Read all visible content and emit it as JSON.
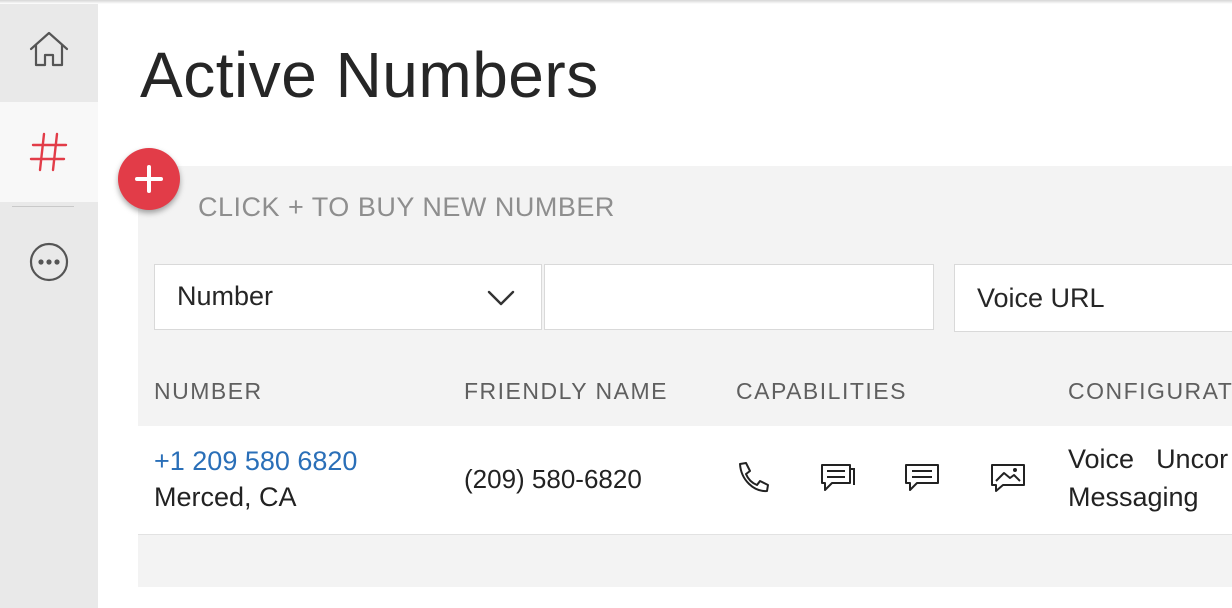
{
  "sidebar": {
    "items": [
      {
        "icon": "home-icon"
      },
      {
        "icon": "hash-icon",
        "active": true
      },
      {
        "icon": "more-icon"
      }
    ]
  },
  "page": {
    "title": "Active Numbers"
  },
  "buy": {
    "text": "CLICK + TO BUY NEW NUMBER"
  },
  "filters": {
    "field_select_value": "Number",
    "search_value": "",
    "voice_url_label": "Voice URL"
  },
  "table": {
    "columns": [
      "NUMBER",
      "FRIENDLY NAME",
      "CAPABILITIES",
      "CONFIGURAT"
    ],
    "rows": [
      {
        "number": "+1 209 580 6820",
        "location": "Merced, CA",
        "friendly_name": "(209) 580-6820",
        "capabilities": [
          "voice-icon",
          "sms-icon",
          "mms-icon",
          "fax-icon"
        ],
        "config": [
          {
            "label": "Voice",
            "value": "Uncor"
          },
          {
            "label": "Messaging",
            "value": ""
          }
        ]
      }
    ]
  },
  "colors": {
    "accent": "#e23c48",
    "link": "#2a6fb8",
    "sidebar_bg": "#e9e9e9"
  }
}
